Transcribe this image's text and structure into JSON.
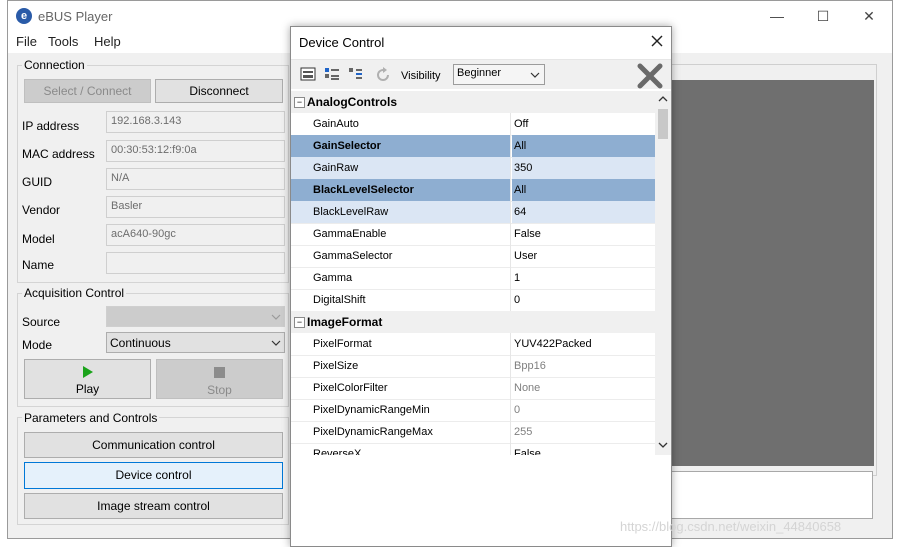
{
  "app": {
    "title": "eBUS Player",
    "icon_letter": "e"
  },
  "menu": [
    "File",
    "Tools",
    "Help"
  ],
  "window_controls": {
    "minimize": "—",
    "maximize": "☐",
    "close": "✕"
  },
  "connection": {
    "label": "Connection",
    "select_connect": "Select / Connect",
    "disconnect": "Disconnect",
    "fields": [
      {
        "label": "IP address",
        "value": "192.168.3.143"
      },
      {
        "label": "MAC address",
        "value": "00:30:53:12:f9:0a"
      },
      {
        "label": "GUID",
        "value": "N/A"
      },
      {
        "label": "Vendor",
        "value": "Basler"
      },
      {
        "label": "Model",
        "value": "acA640-90gc"
      },
      {
        "label": "Name",
        "value": ""
      }
    ]
  },
  "acquisition": {
    "label": "Acquisition Control",
    "source_label": "Source",
    "source_value": "",
    "mode_label": "Mode",
    "mode_value": "Continuous",
    "play": "Play",
    "stop": "Stop"
  },
  "parameters": {
    "label": "Parameters and Controls",
    "communication": "Communication control",
    "device": "Device control",
    "image_stream": "Image stream control"
  },
  "dialog": {
    "title": "Device Control",
    "visibility_label": "Visibility",
    "visibility_value": "Beginner",
    "categories": [
      {
        "name": "AnalogControls",
        "rows": [
          {
            "name": "GainAuto",
            "value": "Off"
          },
          {
            "name": "GainSelector",
            "value": "All"
          },
          {
            "name": "GainRaw",
            "value": "350"
          },
          {
            "name": "BlackLevelSelector",
            "value": "All"
          },
          {
            "name": "BlackLevelRaw",
            "value": "64"
          },
          {
            "name": "GammaEnable",
            "value": "False"
          },
          {
            "name": "GammaSelector",
            "value": "User"
          },
          {
            "name": "Gamma",
            "value": "1"
          },
          {
            "name": "DigitalShift",
            "value": "0"
          }
        ]
      },
      {
        "name": "ImageFormat",
        "rows": [
          {
            "name": "PixelFormat",
            "value": "YUV422Packed"
          },
          {
            "name": "PixelSize",
            "value": "Bpp16"
          },
          {
            "name": "PixelColorFilter",
            "value": "None"
          },
          {
            "name": "PixelDynamicRangeMin",
            "value": "0"
          },
          {
            "name": "PixelDynamicRangeMax",
            "value": "255"
          },
          {
            "name": "ReverseX",
            "value": "False"
          }
        ]
      }
    ]
  },
  "watermark": "https://blog.csdn.net/weixin_44840658"
}
